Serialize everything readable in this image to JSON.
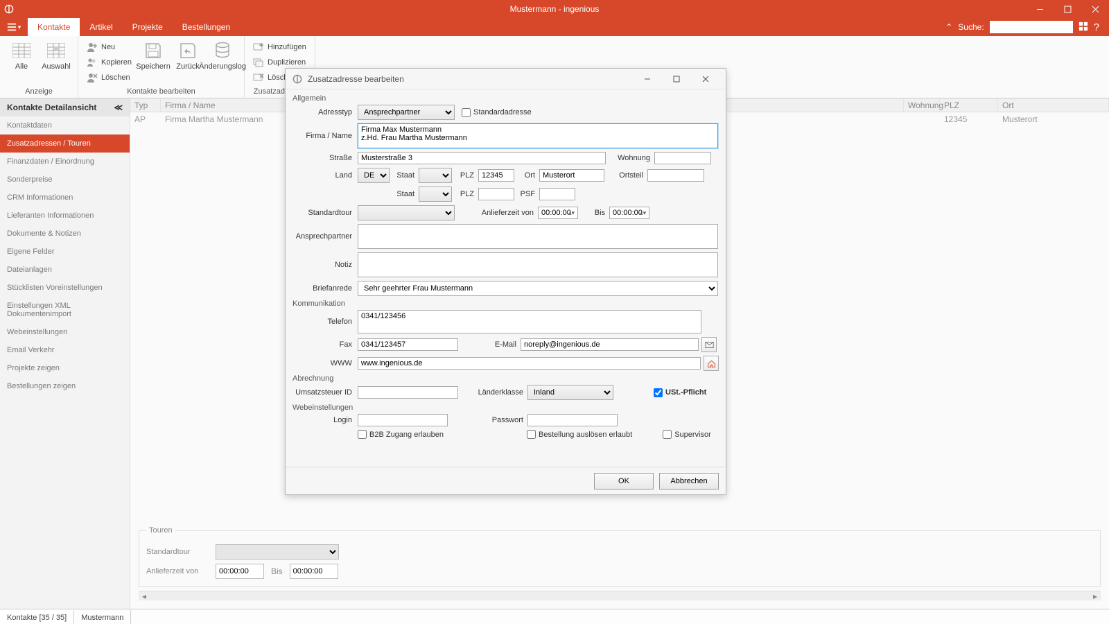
{
  "app": {
    "title": "Mustermann - ingenious"
  },
  "menubar": {
    "tabs": [
      "Kontakte",
      "Artikel",
      "Projekte",
      "Bestellungen"
    ],
    "active": 0,
    "search_label": "Suche:"
  },
  "ribbon": {
    "groups": [
      {
        "label": "Anzeige",
        "big": [
          "Alle",
          "Auswahl"
        ]
      },
      {
        "label": "Kontakte bearbeiten",
        "small_col": [
          "Neu",
          "Kopieren",
          "Löschen"
        ],
        "big": [
          "Speichern",
          "Zurück",
          "Änderungslog"
        ]
      },
      {
        "label": "Zusatzadress...",
        "small_col": [
          "Hinzufügen",
          "Duplizieren",
          "Löschen"
        ]
      }
    ]
  },
  "sidebar": {
    "title": "Kontakte Detailansicht",
    "items": [
      "Kontaktdaten",
      "Zusatzadressen / Touren",
      "Finanzdaten / Einordnung",
      "Sonderpreise",
      "CRM Informationen",
      "Lieferanten Informationen",
      "Dokumente & Notizen",
      "Eigene Felder",
      "Dateianlagen",
      "Stücklisten Voreinstellungen",
      "Einstellungen XML Dokumentenimport",
      "Webeinstellungen",
      "Email Verkehr",
      "Projekte zeigen",
      "Bestellungen zeigen"
    ],
    "active": 1
  },
  "grid": {
    "cols": [
      "Typ",
      "Firma / Name",
      "Wohnung",
      "PLZ",
      "Ort"
    ],
    "rows": [
      {
        "typ": "AP",
        "name": "Firma Martha Mustermann",
        "wohnung": "",
        "plz": "12345",
        "ort": "Musterort"
      }
    ]
  },
  "touren": {
    "legend": "Touren",
    "lbl_standard": "Standardtour",
    "lbl_anlief": "Anlieferzeit von",
    "lbl_bis": "Bis",
    "time_from": "00:00:00",
    "time_to": "00:00:00"
  },
  "statusbar": {
    "left": "Kontakte [35 / 35]",
    "right": "Mustermann"
  },
  "dialog": {
    "title": "Zusatzadresse bearbeiten",
    "sect_allgemein": "Allgemein",
    "lbl_adresstyp": "Adresstyp",
    "adresstyp": "Ansprechpartner",
    "lbl_standardadr": "Standardadresse",
    "lbl_firma": "Firma / Name",
    "firma": "Firma Max Mustermann\nz.Hd. Frau Martha Mustermann",
    "lbl_strasse": "Straße",
    "strasse": "Musterstraße 3",
    "lbl_wohnung": "Wohnung",
    "wohnung": "",
    "lbl_land": "Land",
    "land": "DE",
    "lbl_staat": "Staat",
    "lbl_plz": "PLZ",
    "plz": "12345",
    "lbl_ort": "Ort",
    "ort": "Musterort",
    "lbl_ortsteil": "Ortsteil",
    "ortsteil": "",
    "lbl_psf": "PSF",
    "lbl_standardtour": "Standardtour",
    "lbl_anlief_von": "Anlieferzeit von",
    "anlief_von": "00:00:00",
    "lbl_bis": "Bis",
    "anlief_bis": "00:00:00",
    "lbl_ansprech": "Ansprechpartner",
    "ansprech": "",
    "lbl_notiz": "Notiz",
    "notiz": "",
    "lbl_brief": "Briefanrede",
    "brief": "Sehr geehrter Frau Mustermann",
    "sect_komm": "Kommunikation",
    "lbl_telefon": "Telefon",
    "telefon": "0341/123456",
    "lbl_fax": "Fax",
    "fax": "0341/123457",
    "lbl_email": "E-Mail",
    "email": "noreply@ingenious.de",
    "lbl_www": "WWW",
    "www": "www.ingenious.de",
    "sect_abrech": "Abrechnung",
    "lbl_ust": "Umsatzsteuer ID",
    "ust": "",
    "lbl_laenderkl": "Länderklasse",
    "laenderkl": "Inland",
    "lbl_ustpflicht": "USt.-Pflicht",
    "sect_web": "Webeinstellungen",
    "lbl_login": "Login",
    "login": "",
    "lbl_pw": "Passwort",
    "pw": "",
    "lbl_b2b": "B2B Zugang erlauben",
    "lbl_bestell": "Bestellung auslösen erlaubt",
    "lbl_supervisor": "Supervisor",
    "btn_ok": "OK",
    "btn_cancel": "Abbrechen"
  }
}
